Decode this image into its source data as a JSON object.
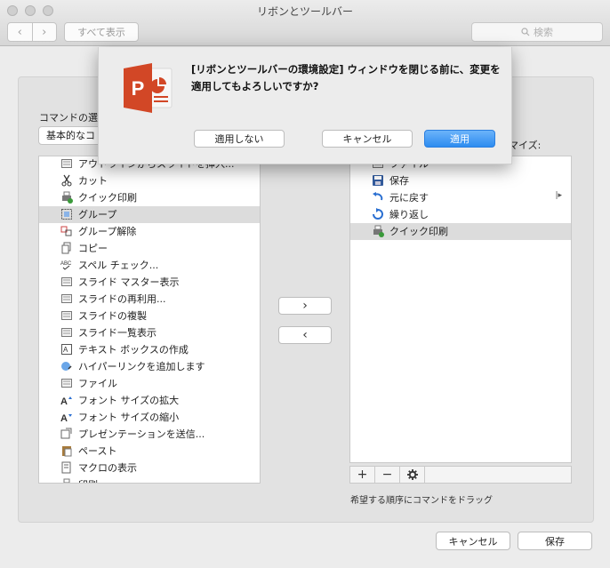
{
  "window": {
    "title": "リボンとツールバー",
    "show_all": "すべて表示",
    "search_placeholder": "検索",
    "nav_back": "‹",
    "nav_forward": "›"
  },
  "dialog": {
    "message": "[リボンとツールバーの環境設定] ウィンドウを閉じる前に、変更を適用してもよろしいですか?",
    "dont_apply": "適用しない",
    "cancel": "キャンセル",
    "apply": "適用",
    "app_icon_letter": "P"
  },
  "left_panel": {
    "label": "コマンドの選",
    "popup_value": "基本的なコ",
    "items": [
      {
        "label": "アウトラインからスライドを挿入...",
        "icon": "outline-insert-icon"
      },
      {
        "label": "カット",
        "icon": "scissors-icon"
      },
      {
        "label": "クイック印刷",
        "icon": "quick-print-icon"
      },
      {
        "label": "グループ",
        "icon": "group-icon",
        "selected": true
      },
      {
        "label": "グループ解除",
        "icon": "ungroup-icon"
      },
      {
        "label": "コピー",
        "icon": "copy-icon"
      },
      {
        "label": "スペル チェック...",
        "icon": "spellcheck-icon"
      },
      {
        "label": "スライド マスター表示",
        "icon": "slide-master-icon"
      },
      {
        "label": "スライドの再利用...",
        "icon": "reuse-slides-icon"
      },
      {
        "label": "スライドの複製",
        "icon": "duplicate-slide-icon"
      },
      {
        "label": "スライド一覧表示",
        "icon": "slide-sorter-icon"
      },
      {
        "label": "テキスト ボックスの作成",
        "icon": "textbox-icon"
      },
      {
        "label": "ハイパーリンクを追加します",
        "icon": "hyperlink-icon"
      },
      {
        "label": "ファイル",
        "icon": "file-icon"
      },
      {
        "label": "フォント サイズの拡大",
        "icon": "font-grow-icon"
      },
      {
        "label": "フォント サイズの縮小",
        "icon": "font-shrink-icon"
      },
      {
        "label": "プレゼンテーションを送信...",
        "icon": "send-icon"
      },
      {
        "label": "ペースト",
        "icon": "paste-icon"
      },
      {
        "label": "マクロの表示",
        "icon": "macro-icon"
      },
      {
        "label": "印刷",
        "icon": "print-icon"
      }
    ]
  },
  "right_panel": {
    "label": "スタマイズ:",
    "items": [
      {
        "label": "ファイル",
        "icon": "file-icon"
      },
      {
        "label": "保存",
        "icon": "save-icon"
      },
      {
        "label": "元に戻す",
        "icon": "undo-icon",
        "has_submenu": true
      },
      {
        "label": "繰り返し",
        "icon": "redo-icon"
      },
      {
        "label": "クイック印刷",
        "icon": "quick-print-icon",
        "selected": true
      }
    ],
    "add": "+",
    "remove": "−",
    "drag_hint": "希望する順序にコマンドをドラッグ"
  },
  "move": {
    "add": "›",
    "remove": "‹"
  },
  "footer": {
    "cancel": "キャンセル",
    "save": "保存"
  }
}
